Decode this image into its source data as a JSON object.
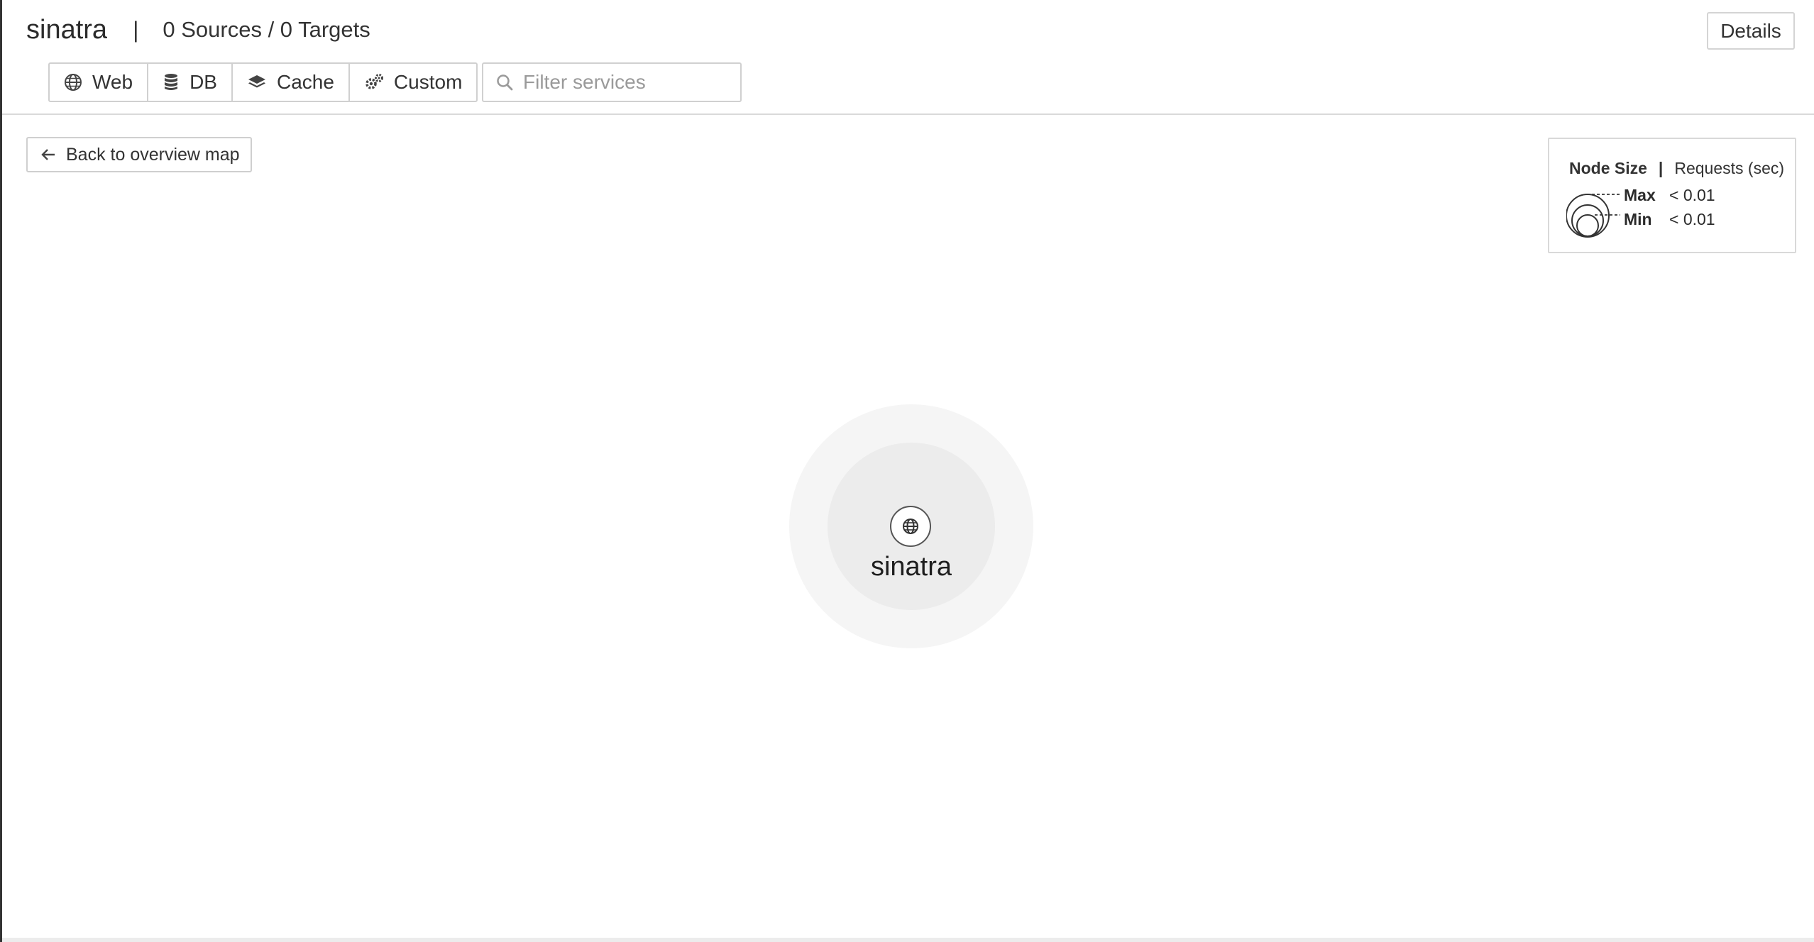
{
  "header": {
    "service_name": "sinatra",
    "separator": "|",
    "summary": "0 Sources / 0 Targets",
    "details_label": "Details"
  },
  "filters": [
    {
      "label": "Web",
      "icon": "globe-icon"
    },
    {
      "label": "DB",
      "icon": "database-icon"
    },
    {
      "label": "Cache",
      "icon": "layers-icon"
    },
    {
      "label": "Custom",
      "icon": "gears-icon"
    }
  ],
  "search": {
    "placeholder": "Filter services",
    "value": "",
    "icon": "search-icon"
  },
  "back_button": {
    "label": "Back to overview map",
    "icon": "arrow-left-icon"
  },
  "legend": {
    "title": "Node Size",
    "separator": "|",
    "metric": "Requests (sec)",
    "max_label": "Max",
    "max_value": "< 0.01",
    "min_label": "Min",
    "min_value": "< 0.01"
  },
  "node": {
    "label": "sinatra",
    "icon": "globe-icon"
  },
  "colors": {
    "border": "#d0d0d0",
    "text": "#2b2b2b",
    "halo_outer": "#f5f5f5",
    "halo_inner": "#ececec"
  }
}
